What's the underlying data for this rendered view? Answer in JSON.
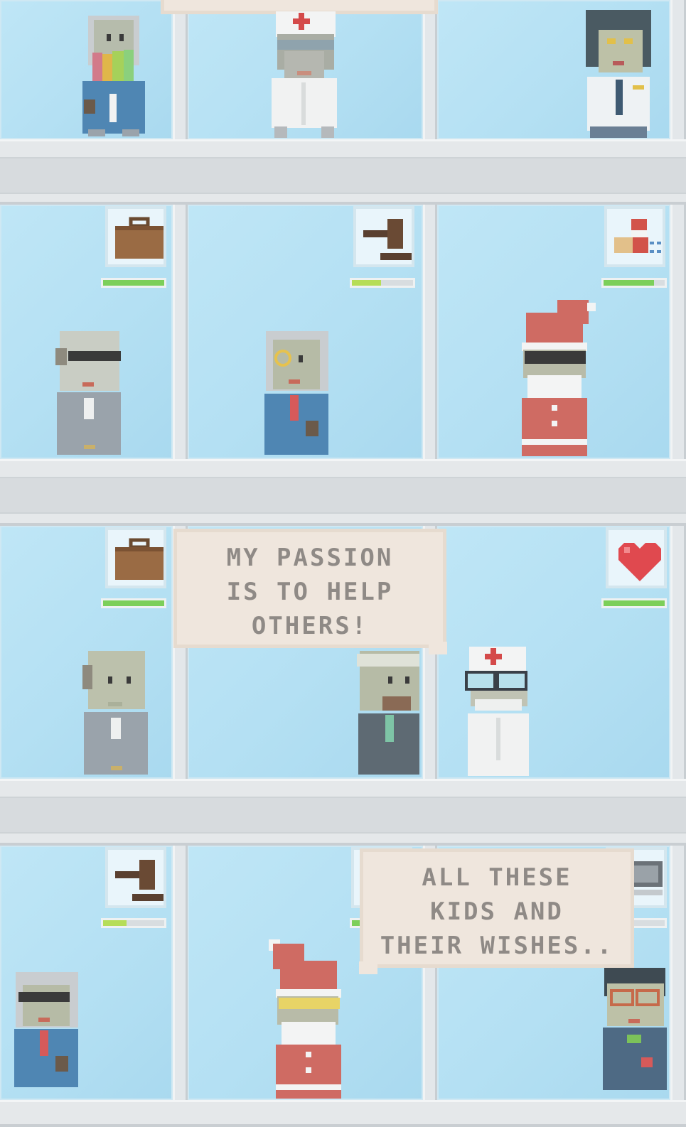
{
  "game": {
    "title": "",
    "floors": [
      {
        "floor": "top",
        "rooms": [
          {
            "room": "left",
            "character": "rainbow-beard-businessman",
            "icon": null,
            "progress": null
          },
          {
            "room": "middle",
            "character": "doctor-sunglasses",
            "icon": null,
            "progress": null
          },
          {
            "room": "right",
            "character": "dark-hair-pilot",
            "icon": null,
            "progress": null
          }
        ]
      },
      {
        "floor": "second",
        "rooms": [
          {
            "room": "left",
            "character": "sunglasses-gray-suit",
            "icon": "briefcase-icon",
            "progress": 1.0
          },
          {
            "room": "middle",
            "character": "monocle-blue-suit",
            "icon": "gavel-icon",
            "progress": 0.48
          },
          {
            "room": "right",
            "character": "santa-sunglasses",
            "icon": "santa-sleigh-icon",
            "progress": 0.82
          }
        ]
      },
      {
        "floor": "third",
        "rooms": [
          {
            "room": "left",
            "character": "bald-gray-suit",
            "icon": "briefcase-icon",
            "progress": 1.0
          },
          {
            "room": "middle",
            "character": "bearded-gray-suit",
            "icon": null,
            "progress": null
          },
          {
            "room": "right",
            "character": "doctor-glasses",
            "icon": "heart-icon",
            "progress": 1.0
          }
        ]
      },
      {
        "floor": "bottom",
        "rooms": [
          {
            "room": "left",
            "character": "sunglasses-blue-suit",
            "icon": "gavel-icon",
            "progress": 0.38
          },
          {
            "room": "middle",
            "character": "santa-yellow-shades",
            "icon": "unknown-icon",
            "progress": null
          },
          {
            "room": "right",
            "character": "glasses-sweater",
            "icon": "computer-icon",
            "progress": 0.5
          }
        ]
      }
    ],
    "speech_bubbles": [
      {
        "lines": [
          "MY PASSION",
          "IS TO HELP",
          "OTHERS!"
        ]
      },
      {
        "lines": [
          "ALL THESE",
          "KIDS AND",
          "THEIR WISHES.."
        ]
      }
    ]
  },
  "colors": {
    "sky": "#b6e1f4",
    "slab": "#e5e8ea",
    "progress_fill": "#7ccf5a",
    "progress_partial": "#b6dd58",
    "bubble_bg": "#efe6dd",
    "bubble_text": "#8f8a86",
    "suit_blue": "#4f86b3",
    "suit_gray": "#8f9aa3",
    "santa_red": "#cf6b63"
  }
}
